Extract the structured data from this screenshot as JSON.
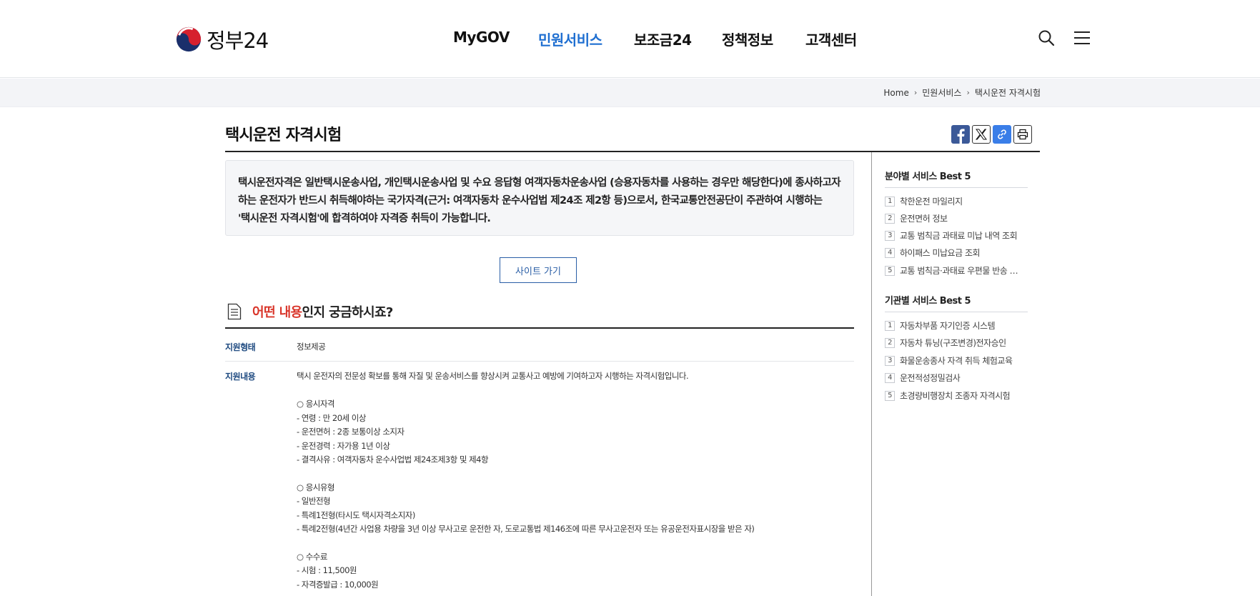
{
  "header": {
    "logo_text": "정부24",
    "nav": [
      "MyGOV",
      "민원서비스",
      "보조금24",
      "정책정보",
      "고객센터"
    ],
    "active_nav": "민원서비스"
  },
  "breadcrumb": [
    "Home",
    "민원서비스",
    "택시운전 자격시험"
  ],
  "page": {
    "title": "택시운전 자격시험",
    "intro_lines": [
      "택시운전자격은 일반택시운송사업, 개인택시운송사업 및 수요 응답형 여객자동차운송사업 (승용자동차를 사용하는 경우만 해당한다)에 종사하고자",
      "하는 운전자가 반드시 취득해야하는 국가자격(근거: 여객자동차 운수사업법 제24조 제2항 등)으로서, 한국교통안전공단이 주관하여 시행하는",
      "'택시운전 자격시험'에 합격하여야 자격증 취득이 가능합니다."
    ],
    "site_button": "사이트 가기"
  },
  "section": {
    "title_highlight": "어떤 내용",
    "title_rest": "인지 궁금하시죠?",
    "support_type_label": "지원형태",
    "support_type_value": "정보제공",
    "support_content_label": "지원내용",
    "support_content_lines": [
      "택시 운전자의 전문성 확보를 통해 자질 및 운송서비스를 향상시켜 교통사고 예방에 기여하고자 시행하는 자격시험입니다.",
      "",
      "○ 응시자격",
      " - 연령 : 만 20세 이상",
      " - 운전면허 : 2종 보통이상 소지자",
      " - 운전경력 : 자가용 1년 이상",
      " - 결격사유 : 여객자동차 운수사업법 제24조제3항 및 제4항",
      "",
      "○ 응시유형",
      " - 일반전형",
      " - 특례1전형(타시도 택시자격소지자)",
      " - 특례2전형(4년간 사업용 차량을 3년 이상 무사고로 운전한 자, 도로교통법 제146조에 따른 무사고운전자 또는 유공운전자표시장을 받은 자)",
      "",
      "○ 수수료",
      " - 시험 : 11,500원",
      " - 자격증발급 : 10,000원"
    ]
  },
  "sidebar": {
    "field_title": "분야별 서비스 Best 5",
    "field_items": [
      "착한운전 마일리지",
      "운전면허 정보",
      "교통 범칙금 과태료 미납 내역 조회",
      "하이패스 미납요금 조회",
      "교통 범칙금·과태료 우편물 반송 …"
    ],
    "agency_title": "기관별 서비스 Best 5",
    "agency_items": [
      "자동차부품 자기인증 시스템",
      "자동차 튜닝(구조변경)전자승인",
      "화물운송종사 자격 취득 체험교육",
      "운전적성정밀검사",
      "초경량비행장치 조종자 자격시험"
    ],
    "numbers": [
      "1",
      "2",
      "3",
      "4",
      "5"
    ]
  },
  "colors": {
    "accent_blue": "#1f6fd1",
    "highlight_red": "#d9352a",
    "label_navy": "#1e4a80"
  }
}
